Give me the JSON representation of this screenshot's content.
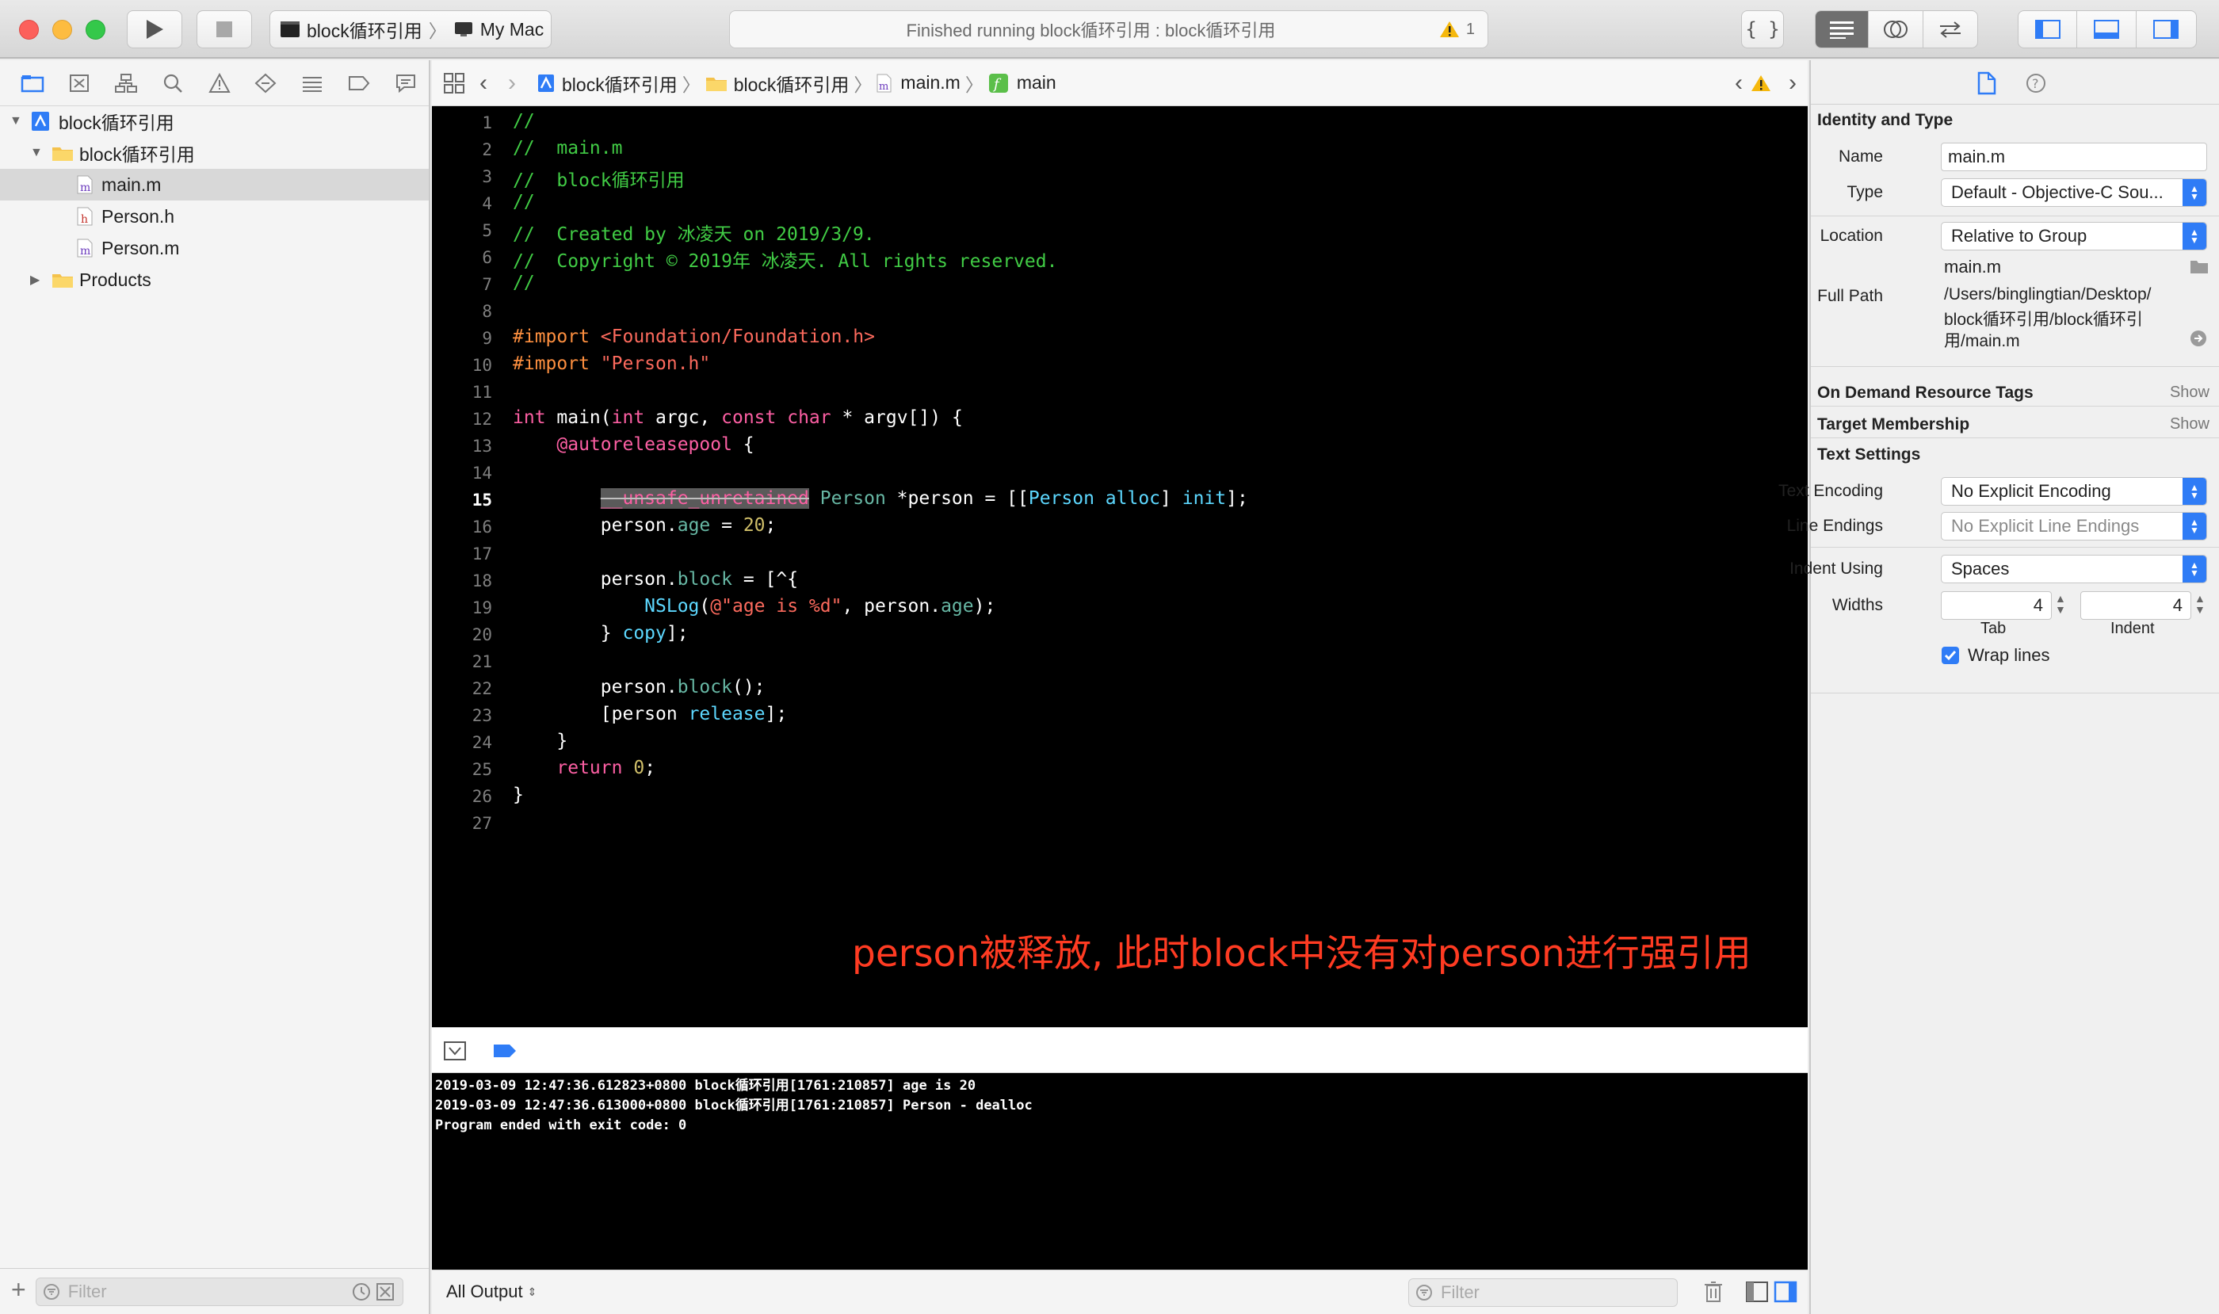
{
  "toolbar": {
    "scheme_target": "block循环引用",
    "scheme_device": "My Mac",
    "activity_status": "Finished running block循环引用 : block循环引用",
    "warning_count": "1"
  },
  "navigator": {
    "items": [
      {
        "label": "block循环引用",
        "kind": "project"
      },
      {
        "label": "block循环引用",
        "kind": "folder"
      },
      {
        "label": "main.m",
        "kind": "m-file",
        "selected": true
      },
      {
        "label": "Person.h",
        "kind": "h-file"
      },
      {
        "label": "Person.m",
        "kind": "m-file"
      },
      {
        "label": "Products",
        "kind": "folder"
      }
    ],
    "filter_placeholder": "Filter"
  },
  "jumpbar": {
    "crumbs": [
      "block循环引用",
      "block循环引用",
      "main.m",
      "main"
    ]
  },
  "editor": {
    "current_line": "15",
    "line_numbers": [
      "1",
      "2",
      "3",
      "4",
      "5",
      "6",
      "7",
      "8",
      "9",
      "10",
      "11",
      "12",
      "13",
      "14",
      "15",
      "16",
      "17",
      "18",
      "19",
      "20",
      "21",
      "22",
      "23",
      "24",
      "25",
      "26",
      "27"
    ],
    "lines": {
      "l1": "//",
      "l2": "//  main.m",
      "l3": "//  block循环引用",
      "l4": "//",
      "l5": "//  Created by 冰凌天 on 2019/3/9.",
      "l6": "//  Copyright © 2019年 冰凌天. All rights reserved.",
      "l7": "//",
      "l9a": "#import ",
      "l9b": "<Foundation/Foundation.h>",
      "l10a": "#import ",
      "l10b": "\"Person.h\"",
      "l12a": "int",
      "l12b": " main(",
      "l12c": "int",
      "l12d": " argc, ",
      "l12e": "const",
      "l12f": " ",
      "l12g": "char",
      "l12h": " * argv[]) {",
      "l13": "@autoreleasepool",
      "l13b": " {",
      "l15a": "__unsafe_unretained",
      "l15b": " Person",
      "l15c": " *person = [[",
      "l15d": "Person",
      "l15e": " alloc",
      "l15f": "] ",
      "l15g": "init",
      "l15h": "];",
      "l16a": "person.",
      "l16b": "age",
      "l16c": " = ",
      "l16d": "20",
      "l16e": ";",
      "l18a": "person.",
      "l18b": "block",
      "l18c": " = [^{",
      "l19a": "NSLog",
      "l19b": "(",
      "l19c": "@\"age is %d\"",
      "l19d": ", person.",
      "l19e": "age",
      "l19f": ");",
      "l20a": "} ",
      "l20b": "copy",
      "l20c": "];",
      "l22a": "person.",
      "l22b": "block",
      "l22c": "();",
      "l23a": "[person ",
      "l23b": "release",
      "l23c": "];",
      "l24": "}",
      "l25a": "return",
      "l25b": " ",
      "l25c": "0",
      "l25d": ";",
      "l26": "}"
    },
    "annotation": "person被释放, 此时block中没有对person进行强引用"
  },
  "console": {
    "lines": [
      "2019-03-09 12:47:36.612823+0800 block循环引用[1761:210857] age is 20",
      "2019-03-09 12:47:36.613000+0800 block循环引用[1761:210857] Person - dealloc",
      "Program ended with exit code: 0"
    ],
    "output_selector": "All Output",
    "filter_placeholder": "Filter"
  },
  "inspector": {
    "identity_title": "Identity and Type",
    "name_label": "Name",
    "name_value": "main.m",
    "type_label": "Type",
    "type_value": "Default - Objective-C Sou...",
    "location_label": "Location",
    "location_value": "Relative to Group",
    "location_file": "main.m",
    "fullpath_label": "Full Path",
    "fullpath_line1": "/Users/binglingtian/Desktop/",
    "fullpath_line2": "block循环引用/block循环引",
    "fullpath_line3": "用/main.m",
    "on_demand_title": "On Demand Resource Tags",
    "target_title": "Target Membership",
    "show_label": "Show",
    "text_settings_title": "Text Settings",
    "encoding_label": "Text Encoding",
    "encoding_value": "No Explicit Encoding",
    "line_endings_label": "Line Endings",
    "line_endings_value": "No Explicit Line Endings",
    "indent_using_label": "Indent Using",
    "indent_using_value": "Spaces",
    "widths_label": "Widths",
    "tab_width": "4",
    "indent_width": "4",
    "tab_label": "Tab",
    "indent_label": "Indent",
    "wrap_label": "Wrap lines"
  },
  "colors": {
    "accent": "#2f7cf6",
    "comment": "#41cc45",
    "keyword": "#fc5fa3",
    "string": "#fc6a5d",
    "annotation": "#ff3b22"
  }
}
